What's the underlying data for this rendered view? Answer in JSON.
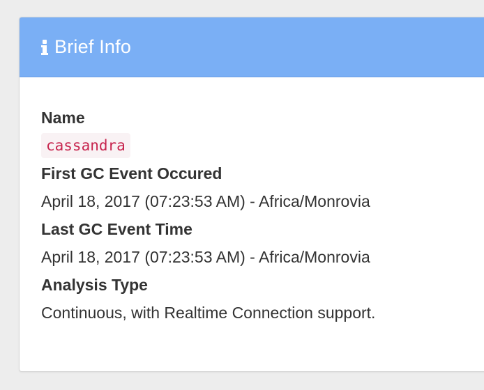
{
  "panel": {
    "title": "Brief Info",
    "icon": "info-icon",
    "header_color": "#7aaff5"
  },
  "fields": {
    "name_label": "Name",
    "name_value": "cassandra",
    "first_gc_label": "First GC Event Occured",
    "first_gc_value": "April 18, 2017 (07:23:53 AM) - Africa/Monrovia",
    "last_gc_label": "Last GC Event Time",
    "last_gc_value": "April 18, 2017 (07:23:53 AM) - Africa/Monrovia",
    "analysis_type_label": "Analysis Type",
    "analysis_type_value": "Continuous, with Realtime Connection support."
  }
}
